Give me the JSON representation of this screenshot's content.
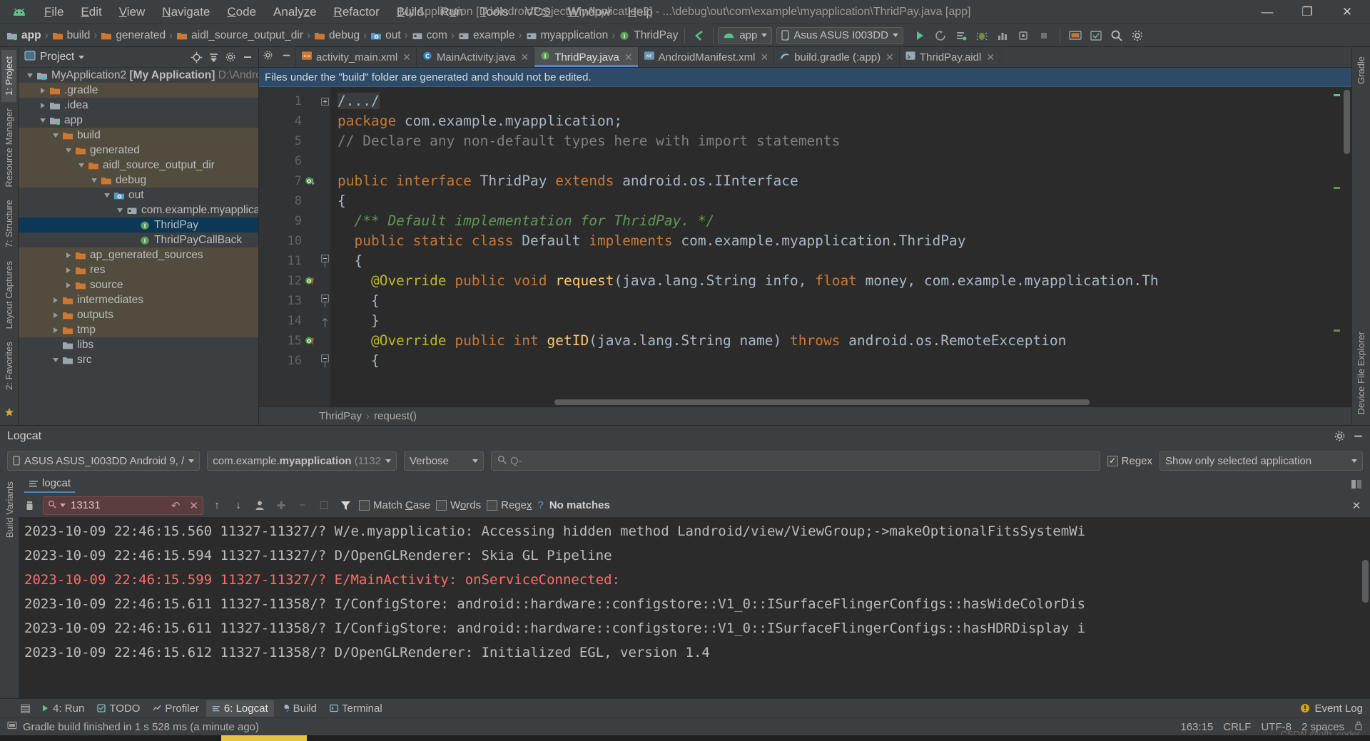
{
  "window": {
    "title": "My Application [D:\\AndroidProject\\MyApplication2] - ...\\debug\\out\\com\\example\\myapplication\\ThridPay.java [app]",
    "minimize": "—",
    "maximize": "❐",
    "close": "✕"
  },
  "menu": [
    {
      "label": "File",
      "mnemonic": "F"
    },
    {
      "label": "Edit",
      "mnemonic": "E"
    },
    {
      "label": "View",
      "mnemonic": "V"
    },
    {
      "label": "Navigate",
      "mnemonic": "N"
    },
    {
      "label": "Code",
      "mnemonic": "C"
    },
    {
      "label": "Analyze",
      "mnemonic": "z"
    },
    {
      "label": "Refactor",
      "mnemonic": "R"
    },
    {
      "label": "Build",
      "mnemonic": "B"
    },
    {
      "label": "Run",
      "mnemonic": "u"
    },
    {
      "label": "Tools",
      "mnemonic": "T"
    },
    {
      "label": "VCS",
      "mnemonic": "S"
    },
    {
      "label": "Window",
      "mnemonic": "W"
    },
    {
      "label": "Help",
      "mnemonic": "H"
    }
  ],
  "breadcrumbs": [
    {
      "label": "app",
      "icon": "module-icon",
      "bold": true
    },
    {
      "label": "build",
      "icon": "folder-orange-icon",
      "bold": false
    },
    {
      "label": "generated",
      "icon": "folder-orange-icon",
      "bold": false
    },
    {
      "label": "aidl_source_output_dir",
      "icon": "folder-orange-icon",
      "bold": false
    },
    {
      "label": "debug",
      "icon": "folder-orange-icon",
      "bold": false
    },
    {
      "label": "out",
      "icon": "folder-generated-icon",
      "bold": false
    },
    {
      "label": "com",
      "icon": "package-icon",
      "bold": false
    },
    {
      "label": "example",
      "icon": "package-icon",
      "bold": false
    },
    {
      "label": "myapplication",
      "icon": "package-icon",
      "bold": false
    },
    {
      "label": "ThridPay",
      "icon": "interface-icon",
      "bold": false
    }
  ],
  "toolbar": {
    "run_config": "app",
    "device": "Asus ASUS I003DD",
    "run_tooltip": "Run",
    "buttons": [
      "run-icon",
      "apply-changes-icon",
      "apply-code-changes-icon",
      "debug-icon",
      "profile-icon",
      "attach-debugger-icon",
      "stop-icon",
      "avd-manager-icon",
      "sdk-manager-icon",
      "search-everywhere-icon",
      "settings-icon"
    ]
  },
  "project_panel": {
    "title": "Project",
    "tree": [
      {
        "label": "MyApplication2",
        "bold_suffix": "[My Application]",
        "dim_suffix": "D:\\Androi",
        "indent": 0,
        "arrow": "down",
        "icon": "project-root-icon",
        "row": "normal"
      },
      {
        "label": ".gradle",
        "indent": 1,
        "arrow": "right",
        "icon": "folder-orange-icon",
        "row": "alt"
      },
      {
        "label": ".idea",
        "indent": 1,
        "arrow": "right",
        "icon": "folder-gray-icon",
        "row": "normal"
      },
      {
        "label": "app",
        "indent": 1,
        "arrow": "down",
        "icon": "module-icon",
        "row": "normal"
      },
      {
        "label": "build",
        "indent": 2,
        "arrow": "down",
        "icon": "folder-orange-icon",
        "row": "alt"
      },
      {
        "label": "generated",
        "indent": 3,
        "arrow": "down",
        "icon": "folder-orange-icon",
        "row": "alt"
      },
      {
        "label": "aidl_source_output_dir",
        "indent": 4,
        "arrow": "down",
        "icon": "folder-orange-icon",
        "row": "alt"
      },
      {
        "label": "debug",
        "indent": 5,
        "arrow": "down",
        "icon": "folder-orange-icon",
        "row": "alt"
      },
      {
        "label": "out",
        "indent": 6,
        "arrow": "down",
        "icon": "folder-generated-icon",
        "row": "normal"
      },
      {
        "label": "com.example.myapplica",
        "indent": 7,
        "arrow": "down",
        "icon": "package-icon",
        "row": "normal"
      },
      {
        "label": "ThridPay",
        "indent": 8,
        "arrow": "none",
        "icon": "interface-icon",
        "row": "sel"
      },
      {
        "label": "ThridPayCallBack",
        "indent": 8,
        "arrow": "none",
        "icon": "interface-icon",
        "row": "normal"
      },
      {
        "label": "ap_generated_sources",
        "indent": 3,
        "arrow": "right",
        "icon": "folder-orange-icon",
        "row": "alt"
      },
      {
        "label": "res",
        "indent": 3,
        "arrow": "right",
        "icon": "folder-orange-icon",
        "row": "alt"
      },
      {
        "label": "source",
        "indent": 3,
        "arrow": "right",
        "icon": "folder-orange-icon",
        "row": "alt"
      },
      {
        "label": "intermediates",
        "indent": 2,
        "arrow": "right",
        "icon": "folder-orange-icon",
        "row": "alt"
      },
      {
        "label": "outputs",
        "indent": 2,
        "arrow": "right",
        "icon": "folder-orange-icon",
        "row": "alt"
      },
      {
        "label": "tmp",
        "indent": 2,
        "arrow": "right",
        "icon": "folder-orange-icon",
        "row": "alt"
      },
      {
        "label": "libs",
        "indent": 2,
        "arrow": "none",
        "icon": "folder-gray-icon",
        "row": "normal"
      },
      {
        "label": "src",
        "indent": 2,
        "arrow": "down",
        "icon": "folder-gray-icon",
        "row": "normal"
      }
    ]
  },
  "left_strip": [
    {
      "label": "1: Project",
      "active": true
    },
    {
      "label": "Resource Manager",
      "active": false
    },
    {
      "label": "7: Structure",
      "active": false
    },
    {
      "label": "Layout Captures",
      "active": false
    },
    {
      "label": "2: Favorites",
      "active": false
    }
  ],
  "right_strip": [
    {
      "label": "Gradle",
      "active": false
    },
    {
      "label": "Device File Explorer",
      "active": false
    }
  ],
  "logcat_left_strip": [
    {
      "label": "Build Variants",
      "active": false
    }
  ],
  "editor": {
    "tabs": [
      {
        "label": "activity_main.xml",
        "icon": "xml-layout-icon",
        "active": false
      },
      {
        "label": "MainActivity.java",
        "icon": "class-icon",
        "active": false
      },
      {
        "label": "ThridPay.java",
        "icon": "interface-icon",
        "active": true
      },
      {
        "label": "AndroidManifest.xml",
        "icon": "manifest-icon",
        "active": false
      },
      {
        "label": "build.gradle (:app)",
        "icon": "gradle-icon",
        "active": false
      },
      {
        "label": "ThridPay.aidl",
        "icon": "aidl-icon",
        "active": false
      }
    ],
    "banner": "Files under the \"build\" folder are generated and should not be edited.",
    "breadcrumb": [
      "ThridPay",
      "request()"
    ],
    "lines": [
      {
        "num": "1",
        "mark": "",
        "fold": "plus",
        "tokens": [
          {
            "t": "/.../",
            "c": "hl-fold pl"
          }
        ]
      },
      {
        "num": "4",
        "mark": "",
        "fold": "",
        "tokens": [
          {
            "t": "package ",
            "c": "kw"
          },
          {
            "t": "com.example.myapplication;",
            "c": "pl"
          }
        ]
      },
      {
        "num": "5",
        "mark": "",
        "fold": "",
        "tokens": [
          {
            "t": "// Declare any non-default types here with import statements",
            "c": "cmt"
          }
        ]
      },
      {
        "num": "6",
        "mark": "",
        "fold": "",
        "tokens": [
          {
            "t": "",
            "c": "pl"
          }
        ]
      },
      {
        "num": "7",
        "mark": "impl-down",
        "fold": "",
        "tokens": [
          {
            "t": "public interface ",
            "c": "kw"
          },
          {
            "t": "ThridPay ",
            "c": "cls"
          },
          {
            "t": "extends ",
            "c": "kw"
          },
          {
            "t": "android.os.IInterface",
            "c": "pl"
          }
        ]
      },
      {
        "num": "8",
        "mark": "",
        "fold": "",
        "tokens": [
          {
            "t": "{",
            "c": "pl"
          }
        ]
      },
      {
        "num": "9",
        "mark": "",
        "fold": "",
        "tokens": [
          {
            "t": "  /** Default implementation for ThridPay. */",
            "c": "doc"
          }
        ]
      },
      {
        "num": "10",
        "mark": "",
        "fold": "",
        "tokens": [
          {
            "t": "  public static class ",
            "c": "kw"
          },
          {
            "t": "Default ",
            "c": "cls"
          },
          {
            "t": "implements ",
            "c": "kw"
          },
          {
            "t": "com.example.myapplication.ThridPay",
            "c": "pl"
          }
        ]
      },
      {
        "num": "11",
        "mark": "",
        "fold": "minus",
        "tokens": [
          {
            "t": "  {",
            "c": "pl"
          }
        ]
      },
      {
        "num": "12",
        "mark": "override-up",
        "fold": "",
        "tokens": [
          {
            "t": "    @Override ",
            "c": "anno"
          },
          {
            "t": "public void ",
            "c": "kw"
          },
          {
            "t": "request",
            "c": "mth"
          },
          {
            "t": "(java.lang.String info, ",
            "c": "pl"
          },
          {
            "t": "float ",
            "c": "kw"
          },
          {
            "t": "money, com.example.myapplication.Th",
            "c": "pl"
          }
        ]
      },
      {
        "num": "13",
        "mark": "",
        "fold": "minus",
        "tokens": [
          {
            "t": "    {",
            "c": "pl"
          }
        ]
      },
      {
        "num": "14",
        "mark": "",
        "fold": "end",
        "tokens": [
          {
            "t": "    }",
            "c": "pl"
          }
        ]
      },
      {
        "num": "15",
        "mark": "override-up",
        "fold": "",
        "tokens": [
          {
            "t": "    @Override ",
            "c": "anno"
          },
          {
            "t": "public int ",
            "c": "kw"
          },
          {
            "t": "getID",
            "c": "mth"
          },
          {
            "t": "(java.lang.String name) ",
            "c": "pl"
          },
          {
            "t": "throws ",
            "c": "kw"
          },
          {
            "t": "android.os.RemoteException",
            "c": "pl"
          }
        ]
      },
      {
        "num": "16",
        "mark": "",
        "fold": "minus",
        "tokens": [
          {
            "t": "    {",
            "c": "pl"
          }
        ]
      }
    ]
  },
  "logcat": {
    "title": "Logcat",
    "device": "ASUS ASUS_I003DD Android 9, /",
    "process": "com.example.myapplication (1132",
    "process_bold": "myapplication",
    "log_level": "Verbose",
    "search_placeholder": "Q-",
    "regex_label": "Regex",
    "regex_checked": true,
    "filter": "Show only selected application",
    "tab": "logcat",
    "find": {
      "query": "13131",
      "match_case": "Match Case",
      "words": "Words",
      "regex": "Regex",
      "help": "?",
      "status": "No matches"
    },
    "lines": [
      {
        "text": "2023-10-09 22:46:15.560 11327-11327/? W/e.myapplicatio: Accessing hidden method Landroid/view/ViewGroup;->makeOptionalFitsSystemWi",
        "level": "warn"
      },
      {
        "text": "2023-10-09 22:46:15.594 11327-11327/? D/OpenGLRenderer: Skia GL Pipeline",
        "level": "debug"
      },
      {
        "text": "2023-10-09 22:46:15.599 11327-11327/? E/MainActivity: onServiceConnected:",
        "level": "error"
      },
      {
        "text": "2023-10-09 22:46:15.611 11327-11358/? I/ConfigStore: android::hardware::configstore::V1_0::ISurfaceFlingerConfigs::hasWideColorDis",
        "level": "info"
      },
      {
        "text": "2023-10-09 22:46:15.611 11327-11358/? I/ConfigStore: android::hardware::configstore::V1_0::ISurfaceFlingerConfigs::hasHDRDisplay i",
        "level": "info"
      },
      {
        "text": "2023-10-09 22:46:15.612 11327-11358/? D/OpenGLRenderer: Initialized EGL, version 1.4",
        "level": "debug"
      }
    ]
  },
  "bottom_tabs": [
    {
      "label": "4: Run",
      "icon": "run-icon",
      "active": false
    },
    {
      "label": "TODO",
      "icon": "todo-icon",
      "active": false
    },
    {
      "label": "Profiler",
      "icon": "profiler-icon",
      "active": false
    },
    {
      "label": "6: Logcat",
      "icon": "logcat-icon",
      "active": true
    },
    {
      "label": "Build",
      "icon": "build-icon",
      "active": false
    },
    {
      "label": "Terminal",
      "icon": "terminal-icon",
      "active": false
    }
  ],
  "event_log": "Event Log",
  "status_bar": {
    "message": "Gradle build finished in 1 s 528 ms (a minute ago)",
    "position": "163:15",
    "line_sep": "CRLF",
    "encoding": "UTF-8",
    "indent": "2 spaces",
    "watermark": "CSDN @qfh_coder"
  }
}
